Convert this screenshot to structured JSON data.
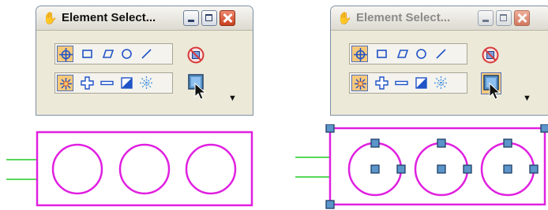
{
  "windows": [
    {
      "title": "Element Select...",
      "state": "active",
      "title_icon": "hand-icon",
      "controls": [
        "minimize-button",
        "maximize-button",
        "close-button"
      ],
      "row1_tools": [
        "element-selection-icon",
        "rectangle-select-icon",
        "shape-select-icon",
        "circle-select-icon",
        "line-select-icon"
      ],
      "row2_tools": [
        "new-selection-icon",
        "add-to-selection-icon",
        "subtract-from-selection-icon",
        "invert-selection-icon",
        "clear-selection-icon"
      ],
      "side_tools": [
        "clear-selection-button",
        "select-all-button"
      ],
      "dropdown": "▼"
    },
    {
      "title": "Element Select...",
      "state": "inactive",
      "title_icon": "hand-icon",
      "controls": [
        "minimize-button",
        "maximize-button",
        "close-button"
      ],
      "row1_tools": [
        "element-selection-icon",
        "rectangle-select-icon",
        "shape-select-icon",
        "circle-select-icon",
        "line-select-icon"
      ],
      "row2_tools": [
        "new-selection-icon",
        "add-to-selection-icon",
        "subtract-from-selection-icon",
        "invert-selection-icon",
        "clear-selection-icon"
      ],
      "side_tools": [
        "clear-selection-button",
        "select-all-button"
      ],
      "dropdown": "▼"
    }
  ],
  "colors": {
    "element": "#e020e0",
    "leader_lines": "#22cc22",
    "handle_fill": "#5b95c9",
    "handle_border": "#1f3f66",
    "selected_tool_bg": "#f9c97a"
  },
  "diagrams": [
    {
      "state": "unselected",
      "circles": 3,
      "handles": 0
    },
    {
      "state": "selected",
      "circles": 3,
      "handles": 15
    }
  ]
}
